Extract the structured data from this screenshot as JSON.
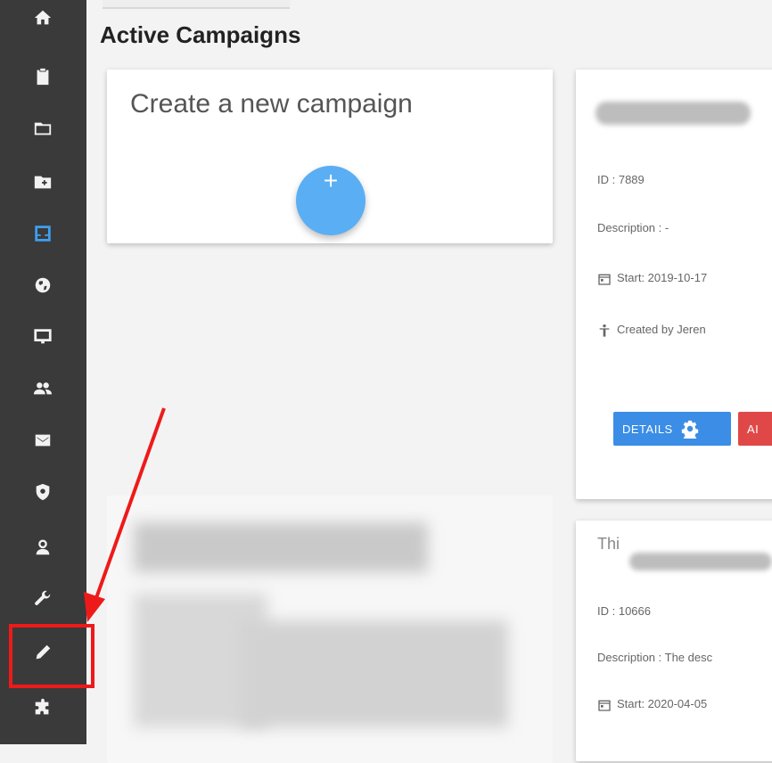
{
  "sidebar": {
    "items": [
      {
        "name": "home-icon"
      },
      {
        "name": "clipboard-icon"
      },
      {
        "name": "folder-icon"
      },
      {
        "name": "folder-add-icon"
      },
      {
        "name": "inbox-icon",
        "active": true
      },
      {
        "name": "globe-icon"
      },
      {
        "name": "monitor-icon"
      },
      {
        "name": "users-icon"
      },
      {
        "name": "mail-icon"
      },
      {
        "name": "shield-icon"
      },
      {
        "name": "user-icon"
      },
      {
        "name": "wrench-icon"
      },
      {
        "name": "pencil-icon",
        "highlighted": true
      },
      {
        "name": "puzzle-icon"
      }
    ],
    "active_color": "#3ea0f2",
    "background": "#3a3a3a"
  },
  "page": {
    "title": "Active Campaigns"
  },
  "create_card": {
    "title": "Create a new campaign",
    "plus": "+"
  },
  "campaign_1": {
    "id": "ID : 7889",
    "description": "Description : -",
    "start": "Start: 2019-10-17",
    "created_by": "Created by Jeren",
    "details_label": "DETAILS",
    "second_button_label": "AI"
  },
  "campaign_2": {
    "title_prefix": "Thi",
    "id": "ID : 10666",
    "description": "Description : The desc",
    "start": "Start: 2020-04-05"
  },
  "annotation": {
    "color": "#ee1a1a"
  }
}
